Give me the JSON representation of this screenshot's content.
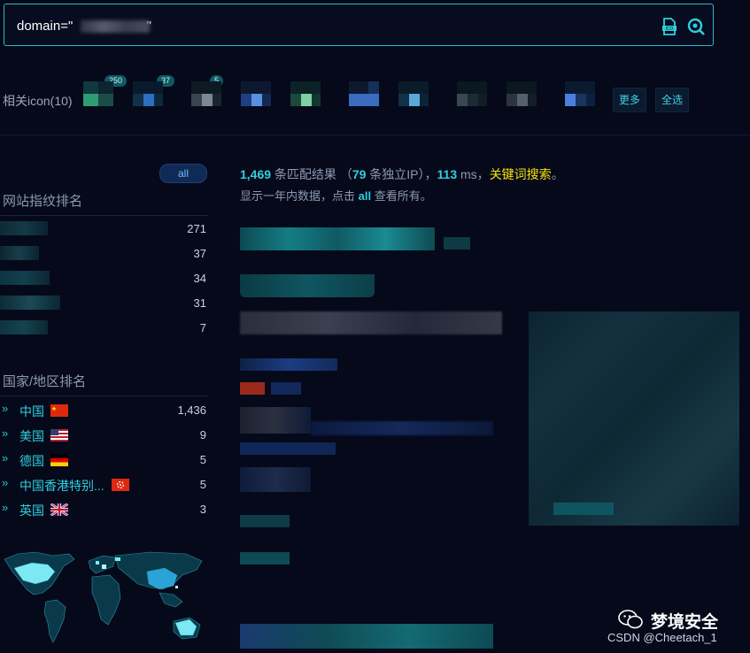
{
  "search": {
    "query_prefix": "domain=\"",
    "query_suffix": "\""
  },
  "related_icons": {
    "label": "相关icon(10)",
    "badges": [
      "250",
      "37",
      "5"
    ],
    "more_label": "更多",
    "select_all_label": "全选"
  },
  "sidebar": {
    "all_label": "all",
    "fingerprint_title": "网站指纹排名",
    "fingerprint_counts": [
      "271",
      "37",
      "34",
      "31",
      "7"
    ],
    "country_title": "国家/地区排名",
    "countries": [
      {
        "name": "中国",
        "count": "1,436"
      },
      {
        "name": "美国",
        "count": "9"
      },
      {
        "name": "德国",
        "count": "5"
      },
      {
        "name": "中国香港特别...",
        "count": "5"
      },
      {
        "name": "英国",
        "count": "3"
      }
    ]
  },
  "results": {
    "match_count": "1,469",
    "match_text": " 条匹配结果 （",
    "ip_count": "79",
    "ip_text": " 条独立IP），",
    "time_ms": "113",
    "time_text": " ms，",
    "keyword_link": "关键词搜索",
    "end_punct": "。",
    "note_before": "显示一年内数据，点击 ",
    "note_link": "all",
    "note_after": " 查看所有。"
  },
  "watermark": {
    "title": "梦境安全",
    "subtitle": "CSDN @Cheetach_1"
  },
  "colors": {
    "accent": "#2fd0dc",
    "keyword": "#f5e20a",
    "background": "#05091a"
  }
}
